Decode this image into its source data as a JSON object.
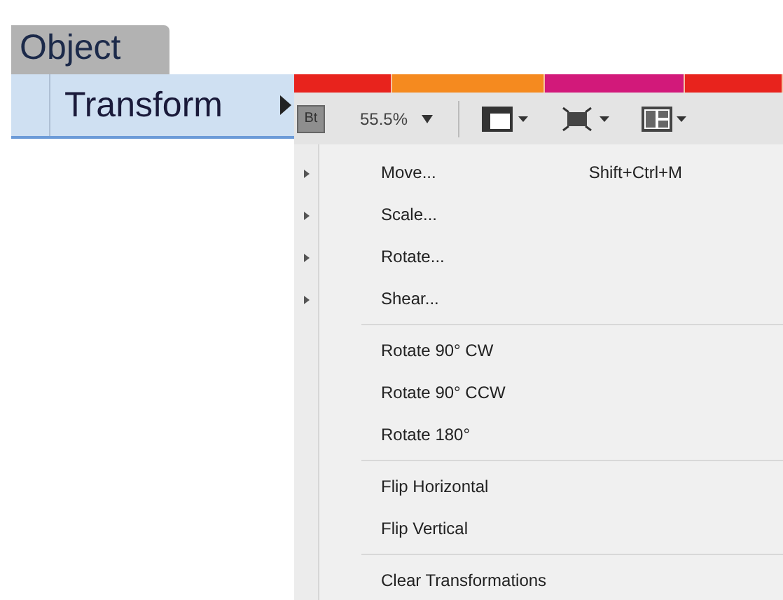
{
  "menubar": {
    "label": "Object",
    "selected": true
  },
  "open_item": {
    "label": "Transform",
    "selected": true
  },
  "color_bar": [
    {
      "color": "#e8231d"
    },
    {
      "color": "#f58a1f"
    },
    {
      "color": "#d2197a"
    },
    {
      "color": "#e8231d"
    }
  ],
  "toolbar": {
    "bridge_label": "Bt",
    "zoom": "55.5%"
  },
  "parent_menu_rows": [
    {
      "submenu": true
    },
    {
      "submenu": true
    },
    {
      "submenu": true
    },
    {
      "submenu": true
    }
  ],
  "submenu": [
    {
      "kind": "item",
      "label": "Move...",
      "shortcut": "Shift+Ctrl+M"
    },
    {
      "kind": "item",
      "label": "Scale..."
    },
    {
      "kind": "item",
      "label": "Rotate..."
    },
    {
      "kind": "item",
      "label": "Shear..."
    },
    {
      "kind": "separator"
    },
    {
      "kind": "item",
      "label": "Rotate 90° CW"
    },
    {
      "kind": "item",
      "label": "Rotate 90° CCW"
    },
    {
      "kind": "item",
      "label": "Rotate 180°"
    },
    {
      "kind": "separator"
    },
    {
      "kind": "item",
      "label": "Flip Horizontal"
    },
    {
      "kind": "item",
      "label": "Flip Vertical"
    },
    {
      "kind": "separator"
    },
    {
      "kind": "item",
      "label": "Clear Transformations"
    }
  ]
}
